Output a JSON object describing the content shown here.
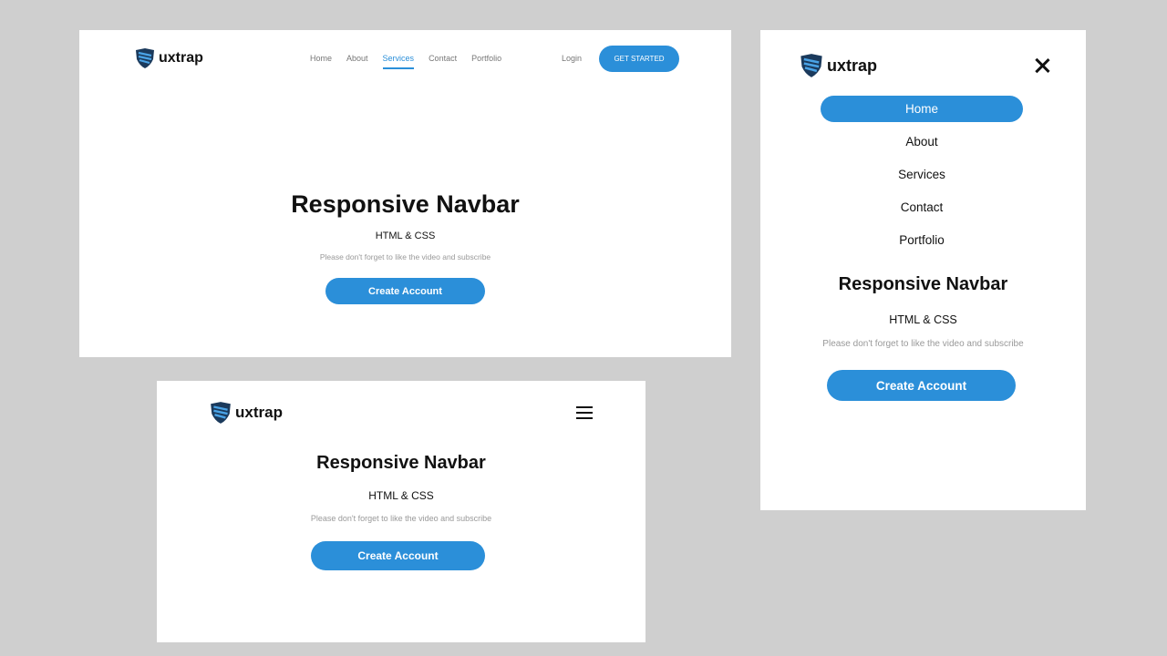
{
  "brand": {
    "name": "uxtrap",
    "icon": "shield-logo-icon",
    "accent": "#2b8fd9",
    "logo_dark": "#1b3a5c"
  },
  "desktop": {
    "nav": [
      {
        "label": "Home",
        "active": false
      },
      {
        "label": "About",
        "active": false
      },
      {
        "label": "Services",
        "active": true
      },
      {
        "label": "Contact",
        "active": false
      },
      {
        "label": "Portfolio",
        "active": false
      }
    ],
    "login_label": "Login",
    "cta_label": "GET STARTED"
  },
  "mobile": {
    "nav": [
      {
        "label": "Home",
        "active": true
      },
      {
        "label": "About",
        "active": false
      },
      {
        "label": "Services",
        "active": false
      },
      {
        "label": "Contact",
        "active": false
      },
      {
        "label": "Portfolio",
        "active": false
      }
    ],
    "menu_icon": "hamburger-menu-icon",
    "close_icon": "close-icon"
  },
  "hero": {
    "title": "Responsive Navbar",
    "subtitle": "HTML & CSS",
    "note": "Please don't forget to like the video and subscribe",
    "button_label": "Create Account"
  }
}
